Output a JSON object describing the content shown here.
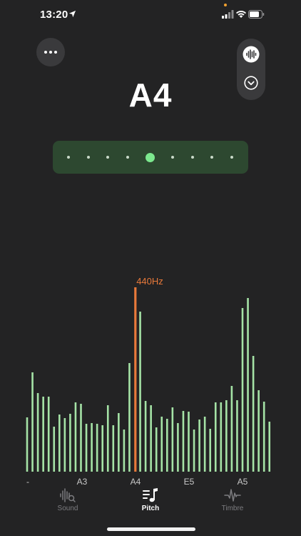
{
  "status_bar": {
    "time": "13:20"
  },
  "tuner": {
    "note": "A4",
    "indicator_dot_count": 9,
    "active_dot_index": 4
  },
  "colors": {
    "accent": "#7ce88e",
    "bar": "#a5e3a6",
    "highlight": "#e8793a",
    "background": "#232324",
    "meter_bg": "#2d4830"
  },
  "chart_data": {
    "type": "bar",
    "peak_label": "440Hz",
    "peak_index": 24,
    "values": [
      76,
      139,
      110,
      105,
      105,
      63,
      80,
      75,
      81,
      97,
      95,
      67,
      68,
      67,
      65,
      93,
      65,
      82,
      59,
      152,
      0,
      224,
      99,
      93,
      62,
      77,
      74,
      90,
      68,
      85,
      84,
      59,
      73,
      77,
      60,
      97,
      97,
      100,
      120,
      100,
      229,
      243,
      162,
      114,
      98,
      70
    ],
    "x_labels": [
      "-",
      "A3",
      "A4",
      "E5",
      "A5"
    ]
  },
  "tabs": [
    {
      "label": "Sound",
      "icon": "waveform-search-icon",
      "active": false
    },
    {
      "label": "Pitch",
      "icon": "music-note-list-icon",
      "active": true
    },
    {
      "label": "Timbre",
      "icon": "waveform-pulse-icon",
      "active": false
    }
  ]
}
